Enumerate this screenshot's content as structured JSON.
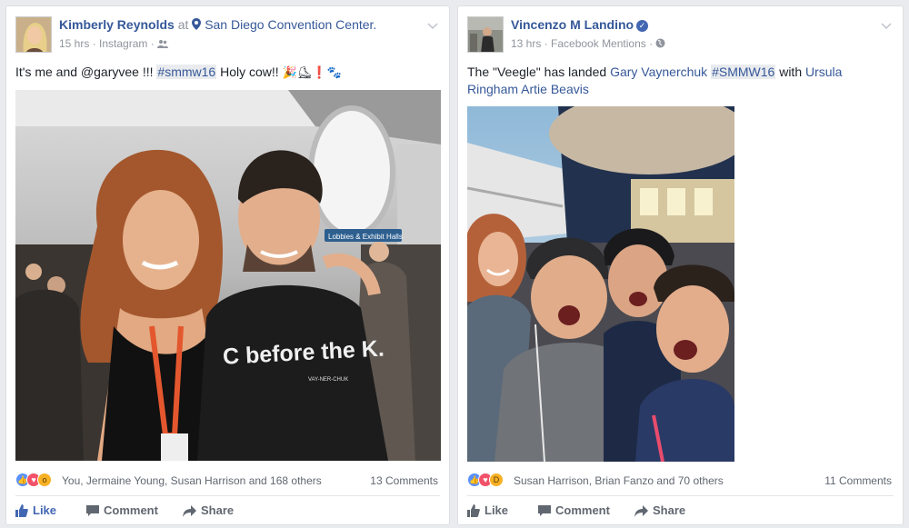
{
  "posts": [
    {
      "author": "Kimberly Reynolds",
      "at_text": "at",
      "location": "San Diego Convention Center.",
      "timestamp": "15 hrs",
      "source": "Instagram",
      "audience_icon": "friends-icon",
      "text_plain": "It's me and @garyvee !!! ",
      "hashtag": "#smmw16",
      "text_after": " Holy cow!! ",
      "emojis": "🎉⛸❗🐾",
      "reaction_names": "You, Jermaine Young, Susan Harrison and 168 others",
      "comments": "13 Comments",
      "actions": {
        "like": "Like",
        "comment": "Comment",
        "share": "Share"
      },
      "photo_tshirt_text": "C before the K.",
      "photo_tshirt_subtext": "VAY-NER-CHUK",
      "photo_sign_text": "Lobbies & Exhibit Halls",
      "like_active": true
    },
    {
      "author": "Vincenzo M Landino",
      "verified": "✓",
      "timestamp": "13 hrs",
      "source": "Facebook Mentions",
      "audience_icon": "globe-icon",
      "text_1": "The \"Veegle\" has landed ",
      "mention_1": "Gary Vaynerchuk",
      "hashtag": "#SMMW16",
      "text_2": " with ",
      "mention_2": "Ursula Ringham",
      "mention_3": "Artie Beavis",
      "reaction_names": "Susan Harrison, Brian Fanzo and 70 others",
      "comments": "11 Comments",
      "actions": {
        "like": "Like",
        "comment": "Comment",
        "share": "Share"
      },
      "like_active": false
    }
  ],
  "colors": {
    "link": "#365899",
    "muted": "#90949c",
    "like_active": "#4267b2",
    "background": "#e9ebee"
  }
}
